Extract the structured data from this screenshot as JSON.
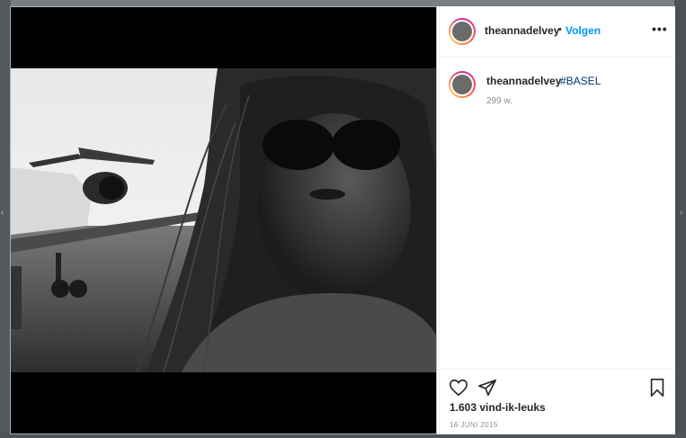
{
  "post": {
    "username": "theannadelvey",
    "separator": "•",
    "follow_label": "Volgen",
    "more_label": "•••",
    "caption_username": "theannadelvey",
    "caption_hashtag": "#BASEL",
    "caption_age": "299 w.",
    "likes_text": "1.603 vind-ik-leuks",
    "date_text": "16 JUNI 2015"
  },
  "icons": {
    "like": "heart-outline-icon",
    "share": "paper-plane-icon",
    "save": "bookmark-outline-icon",
    "more": "more-options-icon"
  },
  "colors": {
    "link": "#0095f6",
    "hashtag": "#00376b",
    "muted": "#8e8e8e",
    "text": "#262626"
  }
}
